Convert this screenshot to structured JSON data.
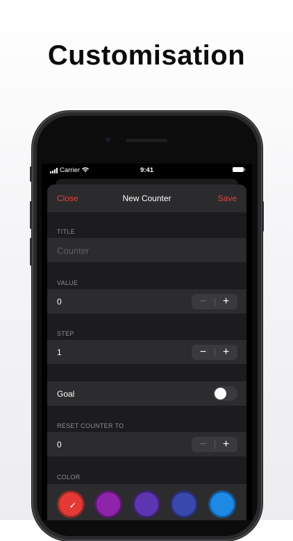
{
  "headline": "Customisation",
  "status_bar": {
    "carrier": "Carrier",
    "time": "9:41"
  },
  "navbar": {
    "close": "Close",
    "title": "New Counter",
    "save": "Save"
  },
  "title_section": {
    "label": "TITLE",
    "placeholder": "Counter",
    "value": ""
  },
  "value_section": {
    "label": "VALUE",
    "value": "0",
    "minus": "−",
    "plus": "+"
  },
  "step_section": {
    "label": "STEP",
    "value": "1",
    "minus": "−",
    "plus": "+"
  },
  "goal": {
    "label": "Goal",
    "enabled": false
  },
  "reset_section": {
    "label": "RESET COUNTER TO",
    "value": "0",
    "minus": "−",
    "plus": "+"
  },
  "color_section": {
    "label": "COLOR",
    "swatches": [
      {
        "name": "red",
        "color": "#e53935",
        "selected": true,
        "check": "✓"
      },
      {
        "name": "purple",
        "color": "#8e24aa",
        "selected": false
      },
      {
        "name": "deep-purple",
        "color": "#5e35b1",
        "selected": false
      },
      {
        "name": "indigo",
        "color": "#3949ab",
        "selected": false
      },
      {
        "name": "blue",
        "color": "#1e88e5",
        "selected": false
      }
    ]
  },
  "colors": {
    "accent": "#e5413c",
    "sheet_bg": "#1c1c1e",
    "row_bg": "#2c2c2e"
  }
}
